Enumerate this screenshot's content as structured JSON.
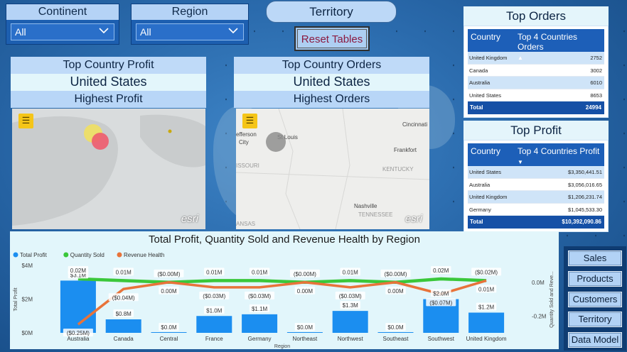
{
  "slicers": [
    {
      "label": "Continent",
      "value": "All"
    },
    {
      "label": "Region",
      "value": "All"
    }
  ],
  "territory_label": "Territory",
  "reset_label": "Reset Tables",
  "profit_card": {
    "title": "Top Country Profit",
    "value": "United States",
    "subtitle": "Highest Profit"
  },
  "orders_card": {
    "title": "Top Country Orders",
    "value": "United States",
    "subtitle": "Highest Orders"
  },
  "map_attribution": "esri",
  "orders_map_labels": [
    "efferson",
    "City",
    "St Louis",
    "ISSOURI",
    "Cincinnati",
    "Frankfort",
    "KENTUCKY",
    "Nashville",
    "TENNESSEE",
    "ANSAS"
  ],
  "top_orders": {
    "title": "Top Orders",
    "col1": "Country",
    "col2": "Top 4 Countries Orders",
    "rows": [
      {
        "country": "United Kingdom",
        "value": "2752"
      },
      {
        "country": "Canada",
        "value": "3002"
      },
      {
        "country": "Australia",
        "value": "6010"
      },
      {
        "country": "United States",
        "value": "8653"
      }
    ],
    "total_label": "Total",
    "total": "24994"
  },
  "top_profit": {
    "title": "Top Profit",
    "col1": "Country",
    "col2": "Top 4 Countries Profit",
    "rows": [
      {
        "country": "United States",
        "value": "$3,350,441.51"
      },
      {
        "country": "Australia",
        "value": "$3,056,016.65"
      },
      {
        "country": "United Kingdom",
        "value": "$1,206,231.74"
      },
      {
        "country": "Germany",
        "value": "$1,045,533.30"
      }
    ],
    "total_label": "Total",
    "total": "$10,392,090.86"
  },
  "chart_data": {
    "type": "bar",
    "title": "Total Profit, Quantity Sold and Revenue Health by Region",
    "xlabel": "Region",
    "ylabel": "Total Profit",
    "y2label": "Quantity Sold and Reve...",
    "ylim": [
      0,
      4
    ],
    "y_ticks": [
      "$0M",
      "$2M",
      "$4M"
    ],
    "y2lim": [
      -0.3,
      0.1
    ],
    "y2_ticks": [
      "0.0M",
      "-0.2M"
    ],
    "categories": [
      "Australia",
      "Canada",
      "Central",
      "France",
      "Germany",
      "Northeast",
      "Northwest",
      "Southeast",
      "Southwest",
      "United Kingdom"
    ],
    "series": [
      {
        "name": "Total Profit",
        "kind": "bar",
        "color": "#1b8ef0",
        "values": [
          3.1,
          0.8,
          0.0,
          1.0,
          1.1,
          0.0,
          1.3,
          0.0,
          2.0,
          1.2
        ],
        "labels": [
          "$3.1M",
          "$0.8M",
          "$0.0M",
          "$1.0M",
          "$1.1M",
          "$0.0M",
          "$1.3M",
          "$0.0M",
          "$2.0M",
          "$1.2M"
        ]
      },
      {
        "name": "Quantity Sold",
        "kind": "line",
        "color": "#3ac73a",
        "values": [
          0.02,
          0.01,
          0.0,
          0.01,
          0.01,
          0.0,
          0.01,
          0.0,
          0.02,
          0.01
        ],
        "labels": [
          "0.02M",
          "0.01M",
          "($0.00M)",
          "0.01M",
          "0.01M",
          "($0.00M)",
          "0.01M",
          "($0.00M)",
          "0.02M",
          "($0.02M)"
        ]
      },
      {
        "name": "Revenue Health",
        "kind": "line",
        "color": "#e8733a",
        "values": [
          -0.25,
          -0.04,
          0.0,
          -0.03,
          -0.03,
          0.0,
          -0.03,
          0.0,
          -0.07,
          0.01
        ],
        "labels": [
          "($0.25M)",
          "($0.04M)",
          "0.00M",
          "($0.03M)",
          "($0.03M)",
          "0.00M",
          "($0.03M)",
          "0.00M",
          "($0.07M)",
          "0.01M"
        ]
      }
    ]
  },
  "nav_buttons": [
    "Sales",
    "Products",
    "Customers",
    "Territory",
    "Data Model"
  ],
  "colors": {
    "accent": "#1d5fb8",
    "bar": "#1b8ef0",
    "quantity": "#3ac73a",
    "revenue": "#e8733a"
  }
}
